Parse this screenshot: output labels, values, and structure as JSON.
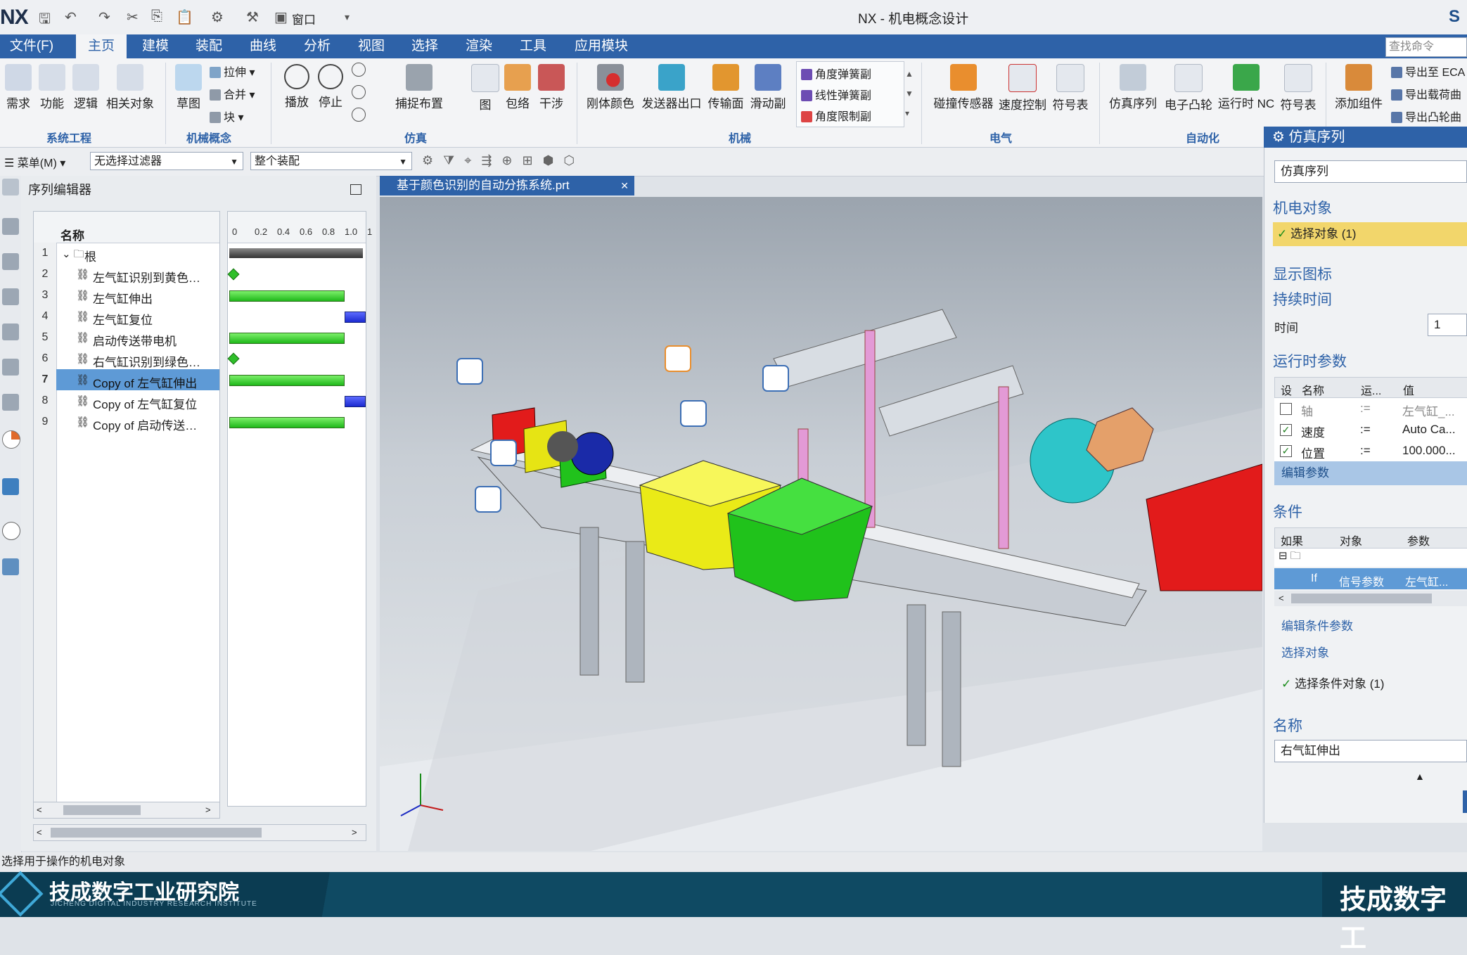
{
  "app": {
    "logo": "NX",
    "title": "NX - 机电概念设计",
    "brand_corner": "S"
  },
  "quick_access": {
    "window_label": "窗口"
  },
  "menubar": {
    "items": [
      "文件(F)",
      "主页",
      "建模",
      "装配",
      "曲线",
      "分析",
      "视图",
      "选择",
      "渲染",
      "工具",
      "应用模块"
    ],
    "active": "主页",
    "search_placeholder": "查找命令"
  },
  "ribbon": {
    "groups": [
      {
        "label": "系统工程",
        "buttons": [
          "需求",
          "功能",
          "逻辑",
          "相关对象"
        ]
      },
      {
        "label": "机械概念",
        "buttons": [
          "草图"
        ],
        "small": [
          "拉伸",
          "合并",
          "块"
        ]
      },
      {
        "label": "仿真",
        "buttons": [
          "播放",
          "停止",
          "捕捉布置",
          "图",
          "包络",
          "干涉"
        ]
      },
      {
        "label": "机械",
        "buttons": [
          "刚体颜色",
          "发送器出口",
          "传输面",
          "滑动副"
        ],
        "small": [
          "角度弹簧副",
          "线性弹簧副",
          "角度限制副"
        ]
      },
      {
        "label": "电气",
        "buttons": [
          "碰撞传感器",
          "速度控制",
          "符号表"
        ]
      },
      {
        "label": "自动化",
        "buttons": [
          "仿真序列",
          "电子凸轮",
          "运行时 NC",
          "符号表"
        ]
      },
      {
        "label": "",
        "buttons": [
          "添加组件"
        ],
        "small": [
          "导出至 ECA",
          "导出载荷曲",
          "导出凸轮曲"
        ]
      }
    ]
  },
  "toolbar": {
    "menu_label": "菜单(M)",
    "filter": "无选择过滤器",
    "scope": "整个装配"
  },
  "sequence_editor": {
    "title": "序列编辑器",
    "column_name": "名称",
    "ticks": [
      "0",
      "0.2",
      "0.4",
      "0.6",
      "0.8",
      "1.0",
      "1"
    ],
    "rows": [
      {
        "num": "1",
        "name": "根",
        "bar": "root"
      },
      {
        "num": "2",
        "name": "左气缸识别到黄色…",
        "bar": "diamond"
      },
      {
        "num": "3",
        "name": "左气缸伸出",
        "bar": "green"
      },
      {
        "num": "4",
        "name": "左气缸复位",
        "bar": "blue"
      },
      {
        "num": "5",
        "name": "启动传送带电机",
        "bar": "green"
      },
      {
        "num": "6",
        "name": "右气缸识别到绿色…",
        "bar": "diamond"
      },
      {
        "num": "7",
        "name": "Copy of 左气缸伸出",
        "bar": "green",
        "selected": true
      },
      {
        "num": "8",
        "name": "Copy of 左气缸复位",
        "bar": "blue"
      },
      {
        "num": "9",
        "name": "Copy of 启动传送…",
        "bar": "green"
      }
    ]
  },
  "viewport": {
    "tab_label": "基于颜色识别的自动分拣系统.prt"
  },
  "sim_panel": {
    "title": "仿真序列",
    "type_value": "仿真序列",
    "sec_object": "机电对象",
    "select_object": "选择对象 (1)",
    "sec_icon": "显示图标",
    "sec_duration": "持续时间",
    "time_label": "时间",
    "time_value": "1",
    "sec_runtime": "运行时参数",
    "runtime_headers": [
      "设",
      "名称",
      "运...",
      "值"
    ],
    "runtime_rows": [
      {
        "checked": false,
        "name": "轴",
        "op": ":=",
        "value": "左气缸_..."
      },
      {
        "checked": true,
        "name": "速度",
        "op": ":=",
        "value": "Auto Ca..."
      },
      {
        "checked": true,
        "name": "位置",
        "op": ":=",
        "value": "100.000..."
      }
    ],
    "edit_params": "编辑参数",
    "sec_condition": "条件",
    "cond_headers": [
      "如果",
      "对象",
      "参数"
    ],
    "cond_row": {
      "if": "If",
      "object": "信号参数",
      "param": "左气缸..."
    },
    "edit_cond_params": "编辑条件参数",
    "select_object_label": "选择对象",
    "select_cond_object": "选择条件对象 (1)",
    "sec_name": "名称",
    "name_value": "右气缸伸出"
  },
  "status": {
    "text": "选择用于操作的机电对象"
  },
  "footer": {
    "brand": "技成数字工业研究院",
    "brand_sub": "JICHENG DIGITAL INDUSTRY RESEARCH INSTITUTE",
    "brand_right": "技成数字工"
  },
  "colors": {
    "accent": "#2e62a8",
    "green_bar": "#1fb81a",
    "blue_bar": "#1b2ad0",
    "footer": "#0b3c52",
    "highlight": "#f2d66b"
  }
}
